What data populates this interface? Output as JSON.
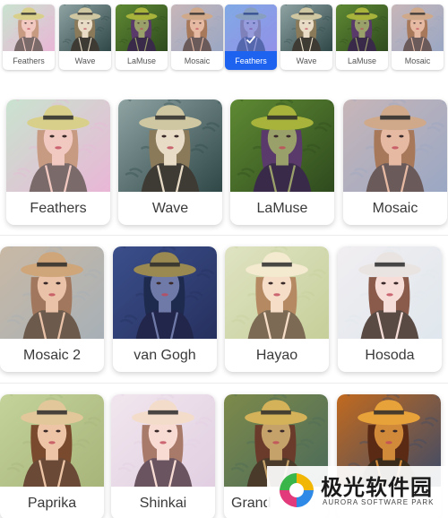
{
  "strip": {
    "items": [
      {
        "label": "Feathers",
        "palette": {
          "bg": "#c9e3cf",
          "bg2": "#e9b6d6",
          "hat": "#d8d08a",
          "skin": "#f1c9c0",
          "hair": "#c79a82",
          "top": "#7a6a6a"
        }
      },
      {
        "label": "Wave",
        "palette": {
          "bg": "#8fa3a3",
          "bg2": "#2f4747",
          "hat": "#cfc6a2",
          "skin": "#e8dcc6",
          "hair": "#8a7a5a",
          "top": "#3e3a34"
        }
      },
      {
        "label": "LaMuse",
        "palette": {
          "bg": "#5f8a33",
          "bg2": "#2e4a1e",
          "hat": "#a7b33b",
          "skin": "#9aa06a",
          "hair": "#5a3a6a",
          "top": "#3a2a4a"
        }
      },
      {
        "label": "Mosaic",
        "palette": {
          "bg": "#c7b6b8",
          "bg2": "#9aa7c4",
          "hat": "#cfa98a",
          "skin": "#e6b9a3",
          "hair": "#a7785a",
          "top": "#6a5a5a"
        }
      },
      {
        "label": "Feathers",
        "selected": true,
        "palette": {
          "bg": "#c9e3cf",
          "bg2": "#e9b6d6",
          "hat": "#d8d08a",
          "skin": "#f1c9c0",
          "hair": "#c79a82",
          "top": "#7a6a6a"
        }
      },
      {
        "label": "Wave",
        "palette": {
          "bg": "#8fa3a3",
          "bg2": "#2f4747",
          "hat": "#cfc6a2",
          "skin": "#e8dcc6",
          "hair": "#8a7a5a",
          "top": "#3e3a34"
        }
      },
      {
        "label": "LaMuse",
        "palette": {
          "bg": "#5f8a33",
          "bg2": "#2e4a1e",
          "hat": "#a7b33b",
          "skin": "#9aa06a",
          "hair": "#5a3a6a",
          "top": "#3a2a4a"
        }
      },
      {
        "label": "Mosaic",
        "palette": {
          "bg": "#c7b6b8",
          "bg2": "#9aa7c4",
          "hat": "#cfa98a",
          "skin": "#e6b9a3",
          "hair": "#a7785a",
          "top": "#6a5a5a"
        }
      }
    ]
  },
  "styles": {
    "items": [
      {
        "label": "Feathers",
        "palette": {
          "bg": "#c9e3cf",
          "bg2": "#e9b6d6",
          "hat": "#d8d08a",
          "skin": "#f1c9c0",
          "hair": "#c79a82",
          "top": "#7a6a6a"
        }
      },
      {
        "label": "Wave",
        "palette": {
          "bg": "#8fa3a3",
          "bg2": "#2f4747",
          "hat": "#cfc6a2",
          "skin": "#e8dcc6",
          "hair": "#8a7a5a",
          "top": "#3e3a34"
        }
      },
      {
        "label": "LaMuse",
        "palette": {
          "bg": "#5f8a33",
          "bg2": "#2e4a1e",
          "hat": "#a7b33b",
          "skin": "#9aa06a",
          "hair": "#5a3a6a",
          "top": "#3a2a4a"
        }
      },
      {
        "label": "Mosaic",
        "palette": {
          "bg": "#c7b6b8",
          "bg2": "#9aa7c4",
          "hat": "#cfa98a",
          "skin": "#e6b9a3",
          "hair": "#a7785a",
          "top": "#6a5a5a"
        }
      },
      {
        "label": "Mosaic 2",
        "palette": {
          "bg": "#c9b9a5",
          "bg2": "#a7b0b7",
          "hat": "#cfa57a",
          "skin": "#e9c2a7",
          "hair": "#a1785d",
          "top": "#6c5a4c"
        }
      },
      {
        "label": "van Gogh",
        "palette": {
          "bg": "#3b4f8c",
          "bg2": "#26305e",
          "hat": "#9a8a52",
          "skin": "#6f7aa8",
          "hair": "#1e2a4e",
          "top": "#22264a"
        }
      },
      {
        "label": "Hayao",
        "palette": {
          "bg": "#dfe3c2",
          "bg2": "#c6cf9a",
          "hat": "#f3ead0",
          "skin": "#f5ddc8",
          "hair": "#b58a63",
          "top": "#7c6a54"
        }
      },
      {
        "label": "Hosoda",
        "palette": {
          "bg": "#f1eef0",
          "bg2": "#dfe7ee",
          "hat": "#e9e4e1",
          "skin": "#f6ddd8",
          "hair": "#8a5a4a",
          "top": "#5a4a44"
        }
      },
      {
        "label": "Paprika",
        "palette": {
          "bg": "#c3d39a",
          "bg2": "#a7b47a",
          "hat": "#e2c79a",
          "skin": "#edc5a6",
          "hair": "#7a4a2e",
          "top": "#6a4a36"
        }
      },
      {
        "label": "Shinkai",
        "palette": {
          "bg": "#f1e6ee",
          "bg2": "#e1cfe1",
          "hat": "#f3dcc9",
          "skin": "#f8dcd4",
          "hair": "#a87a6a",
          "top": "#6a5460"
        }
      },
      {
        "label": "Grand",
        "palette": {
          "bg": "#7d8a4a",
          "bg2": "#4a6a5a",
          "hat": "#d4b25a",
          "skin": "#c5a26a",
          "hair": "#6a3a2a",
          "top": "#4a3a2a"
        }
      },
      {
        "label": "",
        "palette": {
          "bg": "#c26a1e",
          "bg2": "#3a4a6a",
          "hat": "#e8a23a",
          "skin": "#d08a3a",
          "hair": "#5a2a14",
          "top": "#3a2a1a"
        }
      }
    ]
  },
  "watermark": {
    "title": "极光软件园",
    "subtitle": "AURORA SOFTWARE PARK",
    "colors": {
      "a": "#f2b705",
      "b": "#2e8ae6",
      "c": "#e23a7a",
      "d": "#39b54a"
    }
  },
  "colors": {
    "accent": "#1e63f0"
  }
}
